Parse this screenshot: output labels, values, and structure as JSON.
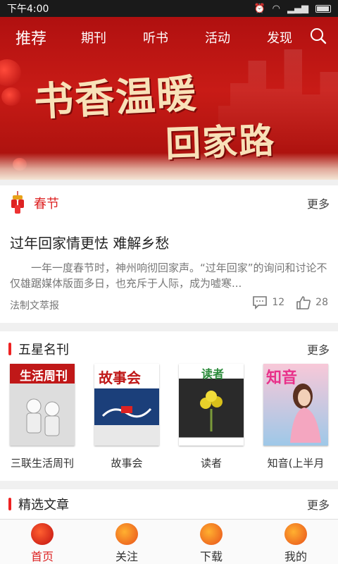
{
  "status_bar": {
    "time": "下午4:00"
  },
  "nav": {
    "items": [
      {
        "label": "推荐",
        "active": true
      },
      {
        "label": "期刊",
        "active": false
      },
      {
        "label": "听书",
        "active": false
      },
      {
        "label": "活动",
        "active": false
      },
      {
        "label": "发现",
        "active": false
      }
    ],
    "search_icon": "search-icon"
  },
  "banner": {
    "line1": "书香温暖",
    "line2": "回家路"
  },
  "spring_section": {
    "title": "春节",
    "more": "更多",
    "article": {
      "title": "过年回家情更怯 难解乡愁",
      "summary": "一年一度春节时，神州响彻回家声。“过年回家”的询问和讨论不仅雄踞媒体版面多日，也充斥于人际，成为嘘寒...",
      "source": "法制文萃报",
      "comments": "12",
      "likes": "28"
    }
  },
  "magazines_section": {
    "title": "五星名刊",
    "more": "更多",
    "items": [
      {
        "name": "三联生活周刊",
        "cover_text": "生活周刊"
      },
      {
        "name": "故事会",
        "cover_text": "故事会"
      },
      {
        "name": "读者",
        "cover_text": "读者"
      },
      {
        "name": "知音(上半月",
        "cover_text": "知音"
      }
    ]
  },
  "picks_section": {
    "title": "精选文章",
    "more": "更多"
  },
  "tabbar": {
    "items": [
      {
        "label": "首页",
        "active": true
      },
      {
        "label": "关注",
        "active": false
      },
      {
        "label": "下载",
        "active": false
      },
      {
        "label": "我的",
        "active": false
      }
    ]
  },
  "colors": {
    "accent": "#dd2222",
    "banner": "#c81b16"
  }
}
